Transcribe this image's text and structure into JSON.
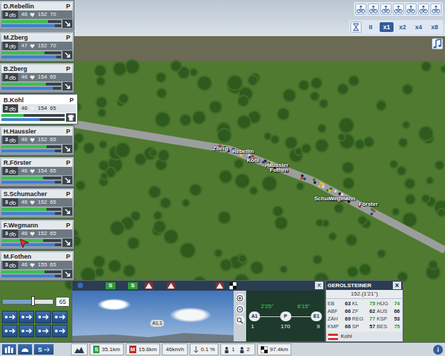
{
  "riders": [
    {
      "name": "D.Rebellin",
      "role": "P",
      "group": "3",
      "hr": "46",
      "weight": "152",
      "form": "70",
      "energy": 0.78,
      "effort": 0.9,
      "selected": false
    },
    {
      "name": "M.Zberg",
      "role": "P",
      "group": "3",
      "hr": "47",
      "weight": "152",
      "form": "70",
      "energy": 0.72,
      "effort": 0.92,
      "selected": false
    },
    {
      "name": "B.Zberg",
      "role": "P",
      "group": "3",
      "hr": "46",
      "weight": "154",
      "form": "65",
      "energy": 0.74,
      "effort": 0.86,
      "selected": false
    },
    {
      "name": "B.Kohl",
      "role": "P",
      "group": "2",
      "hr": "46",
      "weight": "154",
      "form": "65",
      "energy": 0.35,
      "effort": 0.6,
      "selected": true
    },
    {
      "name": "H.Haussler",
      "role": "P",
      "group": "3",
      "hr": "46",
      "weight": "152",
      "form": "65",
      "energy": 0.76,
      "effort": 0.9,
      "selected": false
    },
    {
      "name": "R.Förster",
      "role": "P",
      "group": "3",
      "hr": "46",
      "weight": "154",
      "form": "65",
      "energy": 0.7,
      "effort": 0.9,
      "selected": false
    },
    {
      "name": "S.Schumacher",
      "role": "P",
      "group": "3",
      "hr": "46",
      "weight": "152",
      "form": "65",
      "energy": 0.76,
      "effort": 0.9,
      "selected": false
    },
    {
      "name": "F.Wegmann",
      "role": "P",
      "group": "3",
      "hr": "46",
      "weight": "152",
      "form": "65",
      "energy": 0.7,
      "effort": 0.9,
      "selected": false
    },
    {
      "name": "M.Fothen",
      "role": "P",
      "group": "3",
      "hr": "46",
      "weight": "155",
      "form": "65",
      "energy": 0.72,
      "effort": 0.9,
      "selected": false
    }
  ],
  "scene": {
    "labels": [
      "Zberg",
      "Rebellin",
      "Kohl",
      "Haussler",
      "Fothen",
      "Schumacher",
      "Wegmann",
      "Förster"
    ]
  },
  "speed": {
    "items": [
      {
        "label": "II",
        "selected": false
      },
      {
        "label": "x1",
        "selected": true
      },
      {
        "label": "x2",
        "selected": false
      },
      {
        "label": "x4",
        "selected": false
      },
      {
        "label": "x8",
        "selected": false
      }
    ]
  },
  "effort_slider": {
    "level": 0.6,
    "value": "65"
  },
  "profile": {
    "close": "×",
    "markers": [
      {
        "kind": "start",
        "label": ""
      },
      {
        "kind": "sprint",
        "label": "S"
      },
      {
        "kind": "sprint",
        "label": "S"
      },
      {
        "kind": "climb",
        "label": ""
      },
      {
        "kind": "climb",
        "label": ""
      },
      {
        "kind": "climb",
        "label": ""
      },
      {
        "kind": "finish",
        "label": ""
      }
    ],
    "waypoint": "A1.1"
  },
  "map": {
    "times": [
      "2'25''",
      "6'15''"
    ],
    "points": [
      {
        "label": "A1",
        "value": "1"
      },
      {
        "label": "P",
        "value": "170"
      },
      {
        "label": "E1",
        "value": "9"
      }
    ]
  },
  "team": {
    "name": "GEROLSTEINER",
    "close": "×",
    "summary": "152.(1'21'')",
    "stats": [
      {
        "label": "EB",
        "value": "63",
        "highlight": false
      },
      {
        "label": "KL",
        "value": "75",
        "highlight": true
      },
      {
        "label": "HÜG",
        "value": "74",
        "highlight": true
      },
      {
        "label": "ABF",
        "value": "66",
        "highlight": false
      },
      {
        "label": "ZF",
        "value": "62",
        "highlight": false
      },
      {
        "label": "AUS",
        "value": "66",
        "highlight": false
      },
      {
        "label": "ZÄH",
        "value": "69",
        "highlight": false
      },
      {
        "label": "REG",
        "value": "77",
        "highlight": true
      },
      {
        "label": "KSP",
        "value": "53",
        "highlight": false
      },
      {
        "label": "KMP",
        "value": "66",
        "highlight": false
      },
      {
        "label": "SP",
        "value": "57",
        "highlight": false
      },
      {
        "label": "BES",
        "value": "75",
        "highlight": true
      }
    ],
    "rider": "Kohl"
  },
  "status": {
    "side_button": "S",
    "sprint": {
      "label": "S",
      "value": "35.1km"
    },
    "mountain": {
      "label": "M",
      "value": "15.6km"
    },
    "speed": "46km/h",
    "gradient": "0.1 %",
    "groups": [
      "1",
      "2"
    ],
    "remaining": "97.4km",
    "info": "i"
  }
}
